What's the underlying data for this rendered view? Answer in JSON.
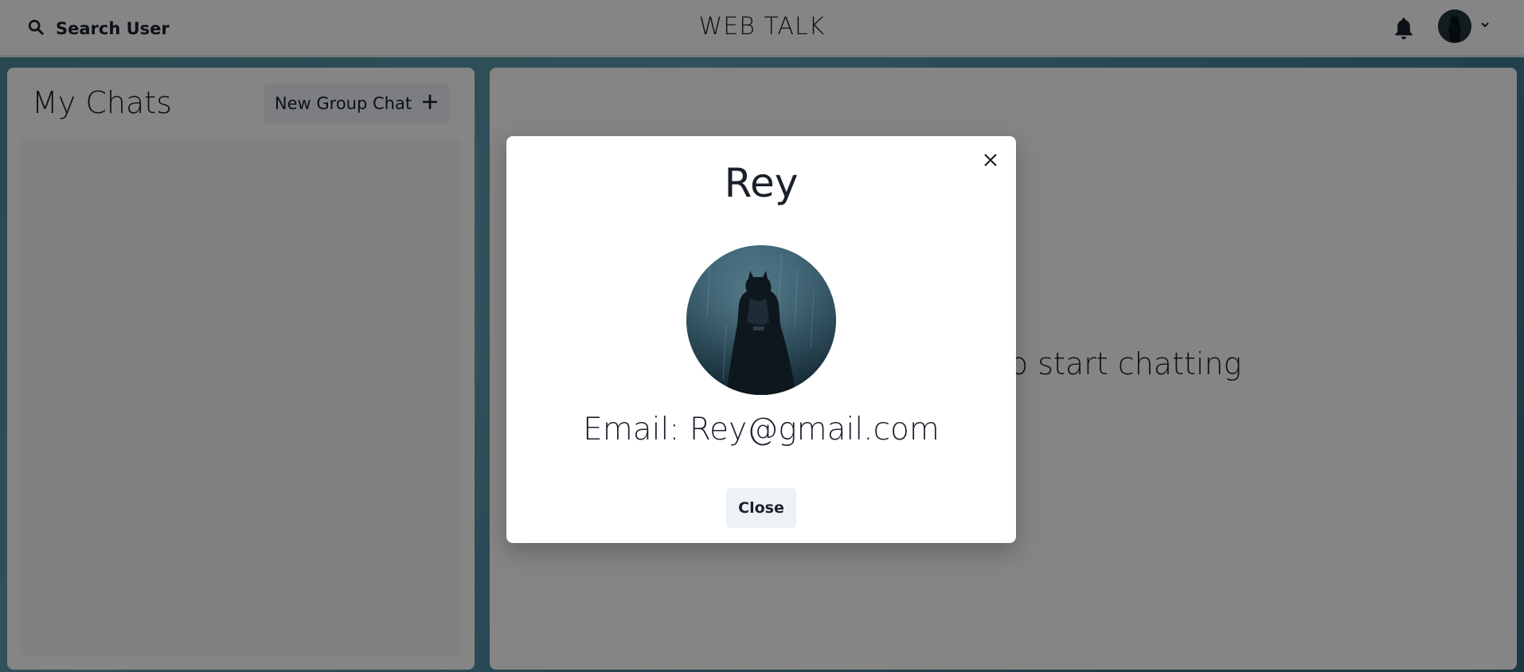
{
  "header": {
    "search_label": "Search User",
    "app_title": "WEB TALK",
    "icons": {
      "search": "search-icon",
      "notifications": "bell-icon",
      "menu": "chevron-down-icon"
    }
  },
  "sidebar": {
    "heading": "My Chats",
    "new_group_label": "New Group Chat"
  },
  "chat_panel": {
    "empty_message": "Click on a user to start chatting"
  },
  "profile_modal": {
    "name": "Rey",
    "email": "Email: Rey@gmail.com",
    "close_label": "Close"
  },
  "colors": {
    "background": "#4d8a9a",
    "button_bg": "#edf2f7",
    "text": "#1a202c"
  }
}
